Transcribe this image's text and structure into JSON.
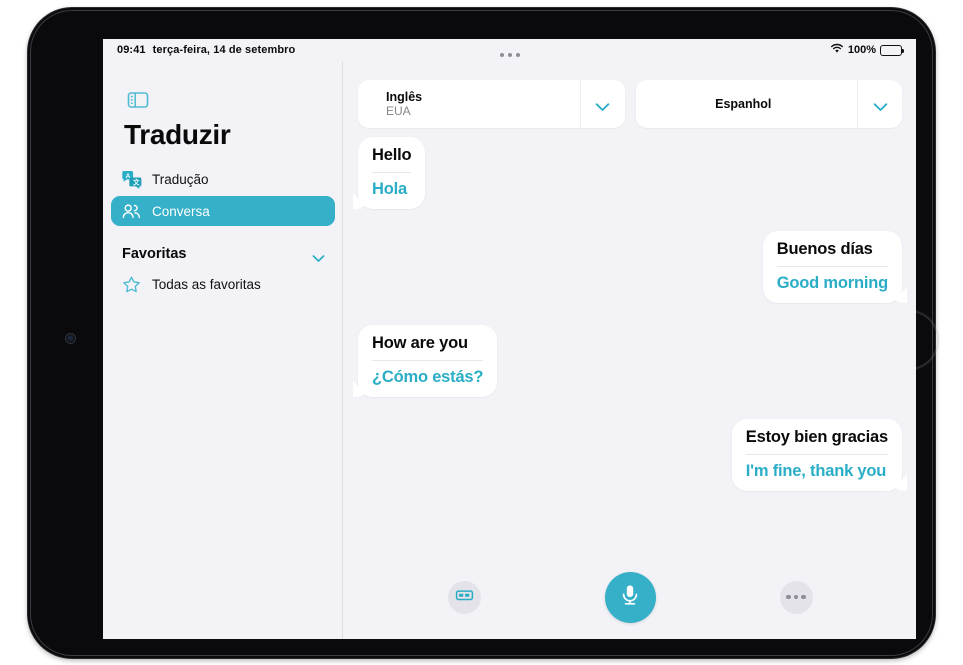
{
  "device": {
    "front_camera_icon": "camera-dot",
    "home_button_icon": "home-button-ring"
  },
  "status_bar": {
    "time": "09:41",
    "date": "terça-feira, 14 de setembro",
    "wifi_icon": "wifi-icon",
    "battery_percent": "100%",
    "battery_icon": "battery-full-icon"
  },
  "multitask_handle_icon": "multitask-handle-icon",
  "sidebar": {
    "toggle_icon": "sidebar-toggle-icon",
    "title": "Traduzir",
    "items": [
      {
        "label": "Tradução",
        "icon": "translate-bubbles-icon",
        "selected": false
      },
      {
        "label": "Conversa",
        "icon": "two-people-icon",
        "selected": true
      }
    ],
    "section": {
      "label": "Favoritas",
      "chevron_icon": "chevron-down-icon"
    },
    "favorites": [
      {
        "label": "Todas as favoritas",
        "icon": "star-outline-icon"
      }
    ]
  },
  "languages": {
    "source": {
      "name": "Inglês",
      "region": "EUA",
      "chevron_icon": "chevron-down-icon"
    },
    "target": {
      "name": "Espanhol",
      "region": "",
      "chevron_icon": "chevron-down-icon"
    }
  },
  "conversation": [
    {
      "side": "left",
      "source": "Hello",
      "target": "Hola"
    },
    {
      "side": "right",
      "source": "Buenos días",
      "target": "Good morning"
    },
    {
      "side": "left",
      "source": "How are you",
      "target": "¿Cómo estás?"
    },
    {
      "side": "right",
      "source": "Estoy bien gracias",
      "target": "I'm fine, thank you"
    }
  ],
  "toolbar": {
    "keyboard_icon": "keyboard-icon",
    "mic_icon": "microphone-icon",
    "more_icon": "more-horizontal-icon"
  },
  "colors": {
    "accent_teal": "#35b0c8",
    "translation_text": "#2aadc6",
    "screen_background": "#f2f2f7",
    "bubble_background": "#ffffff",
    "secondary_text": "#86868b"
  }
}
